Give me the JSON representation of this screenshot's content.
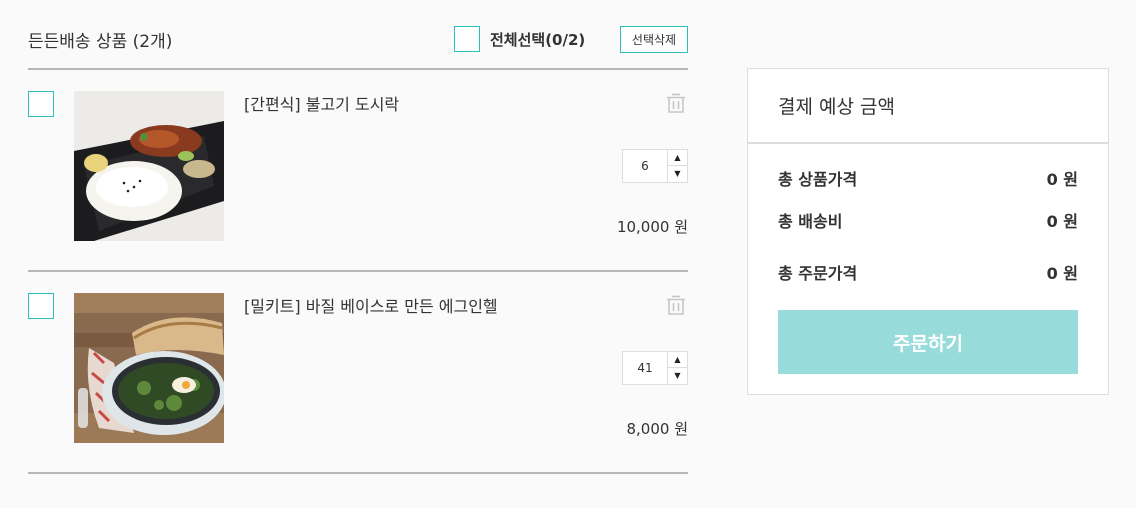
{
  "cart": {
    "title": "든든배송 상품 (2개)",
    "select_all_label": "전체선택(0/2)",
    "delete_selected_label": "선택삭제",
    "items": [
      {
        "name": "[간편식] 불고기 도시락",
        "quantity": "6",
        "price": "10,000 원",
        "image": "bulgogi-lunchbox-photo"
      },
      {
        "name": "[밀키트] 바질 베이스로 만든 에그인헬",
        "quantity": "41",
        "price": "8,000 원",
        "image": "egg-in-hell-skillet-photo"
      }
    ],
    "qty_up": "▲",
    "qty_down": "▼"
  },
  "summary": {
    "title": "결제 예상 금액",
    "rows": [
      {
        "label": "총 상품가격",
        "value": "0 원"
      },
      {
        "label": "총 배송비",
        "value": "0 원"
      },
      {
        "label": "총 주문가격",
        "value": "0 원"
      }
    ],
    "order_button": "주문하기"
  },
  "colors": {
    "accent": "#2ac1bc",
    "order_button_disabled": "#98dbdb",
    "divider": "#b8b8b8"
  },
  "icons": [
    "trash-icon",
    "chevron-up-icon",
    "chevron-down-icon"
  ]
}
